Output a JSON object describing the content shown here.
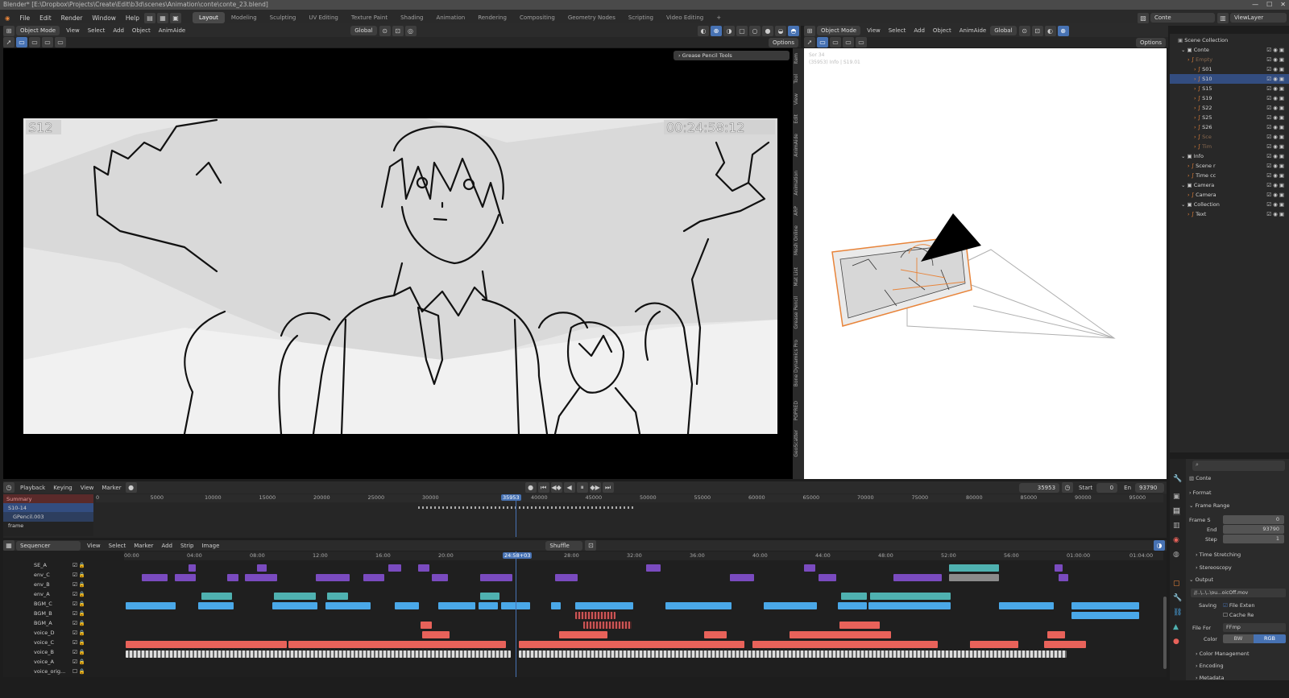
{
  "titlebar": {
    "text": "Blender* [E:\\Dropbox\\Projects\\Create\\Edit\\b3d\\scenes\\Animation\\conte\\conte_23.blend]"
  },
  "menus": [
    "File",
    "Edit",
    "Render",
    "Window",
    "Help"
  ],
  "workspaces": [
    "Layout",
    "Modeling",
    "Sculpting",
    "UV Editing",
    "Texture Paint",
    "Shading",
    "Animation",
    "Rendering",
    "Compositing",
    "Geometry Nodes",
    "Scripting",
    "Video Editing",
    "+"
  ],
  "scene": {
    "name": "Conte",
    "view_layer": "ViewLayer"
  },
  "viewport1": {
    "mode": "Object Mode",
    "menu": [
      "View",
      "Select",
      "Add",
      "Object",
      "AnimAide"
    ],
    "orientation": "Global",
    "options": "Options",
    "gp_tools": "Grease Pencil Tools",
    "shot_label": "S12",
    "timecode": "00:24:58:12",
    "sidebar_tabs": [
      "Item",
      "Tool",
      "View",
      "Edit",
      "AnimAide",
      "Animation",
      "ARP",
      "Mesh Online",
      "Mat List",
      "Grease Pencil",
      "Bone Dynamics Pro",
      "POPRED",
      "GeoScatter"
    ]
  },
  "viewport2": {
    "mode": "Object Mode",
    "menu": [
      "View",
      "Select",
      "Add",
      "Object",
      "AnimAide"
    ],
    "orientation": "Global",
    "options": "Options",
    "info_line1": "Sor 34",
    "info_line2": "(35953) Info | S19.01"
  },
  "outliner": {
    "title": "Scene Collection",
    "rows": [
      {
        "label": "Conte",
        "indent": 1,
        "sel": false
      },
      {
        "label": "Empty",
        "indent": 2,
        "sel": false
      },
      {
        "label": "S01",
        "indent": 3,
        "sel": false
      },
      {
        "label": "S10",
        "indent": 3,
        "sel": true
      },
      {
        "label": "S15",
        "indent": 3,
        "sel": false
      },
      {
        "label": "S19",
        "indent": 3,
        "sel": false
      },
      {
        "label": "S22",
        "indent": 3,
        "sel": false
      },
      {
        "label": "S25",
        "indent": 3,
        "sel": false
      },
      {
        "label": "S26",
        "indent": 3,
        "sel": false
      },
      {
        "label": "Sce",
        "indent": 3,
        "sel": false
      },
      {
        "label": "Tim",
        "indent": 3,
        "sel": false
      },
      {
        "label": "Info",
        "indent": 1,
        "sel": false
      },
      {
        "label": "Scene r",
        "indent": 2,
        "sel": false
      },
      {
        "label": "Time cc",
        "indent": 2,
        "sel": false
      },
      {
        "label": "Camera",
        "indent": 1,
        "sel": false
      },
      {
        "label": "Camera",
        "indent": 2,
        "sel": false
      },
      {
        "label": "Collection",
        "indent": 1,
        "sel": false
      },
      {
        "label": "Text",
        "indent": 2,
        "sel": false
      }
    ]
  },
  "timeline": {
    "menu": [
      "Playback",
      "Keying",
      "View",
      "Marker"
    ],
    "current_frame": "35953",
    "start_label": "Start",
    "start": "0",
    "end_label": "En",
    "end": "93790",
    "ruler": [
      "0",
      "5000",
      "10000",
      "15000",
      "20000",
      "25000",
      "30000",
      "35953",
      "40000",
      "45000",
      "50000",
      "55000",
      "60000",
      "65000",
      "70000",
      "75000",
      "80000",
      "85000",
      "90000",
      "95000"
    ],
    "channels": [
      "Summary",
      "S10-14",
      "GPencil.003",
      "frame"
    ]
  },
  "sequencer": {
    "editor": "Sequencer",
    "menu": [
      "View",
      "Select",
      "Marker",
      "Add",
      "Strip",
      "Image"
    ],
    "shuffle": "Shuffle",
    "current": "24:58+03",
    "ruler": [
      "00:00",
      "04:00",
      "08:00",
      "12:00",
      "16:00",
      "20:00",
      "24:58+03",
      "28:00",
      "32:00",
      "36:00",
      "40:00",
      "44:00",
      "48:00",
      "52:00",
      "56:00",
      "01:00:00",
      "01:04:00"
    ],
    "channels": [
      "SE_A",
      "env_C",
      "env_B",
      "env_A",
      "BGM_C",
      "BGM_B",
      "BGM_A",
      "voice_D",
      "voice_C",
      "voice_B",
      "voice_A",
      "voice_orig..."
    ]
  },
  "properties": {
    "scene": "Conte",
    "format": "Format",
    "frame_range": "Frame Range",
    "frame_start_label": "Frame S",
    "frame_start": "0",
    "end_label": "End",
    "end": "93790",
    "step_label": "Step",
    "step": "1",
    "time_stretching": "Time Stretching",
    "stereoscopy": "Stereoscopy",
    "output": "Output",
    "output_path": "//..\\..\\..\\ou...oicOff.mov",
    "saving": "Saving",
    "file_ext": "File Exten",
    "cache": "Cache Re",
    "file_format_label": "File For",
    "file_format": "FFmp",
    "color_label": "Color",
    "bw": "BW",
    "rgb": "RGB",
    "color_management": "Color Management",
    "encoding": "Encoding",
    "metadata": "Metadata"
  },
  "colors": {
    "accent": "#4772b3",
    "purple": "#7a4bbf",
    "blue": "#4aa8e8",
    "red": "#e8625a",
    "teal": "#4fb1b0",
    "camera_orange": "#e8843a"
  }
}
